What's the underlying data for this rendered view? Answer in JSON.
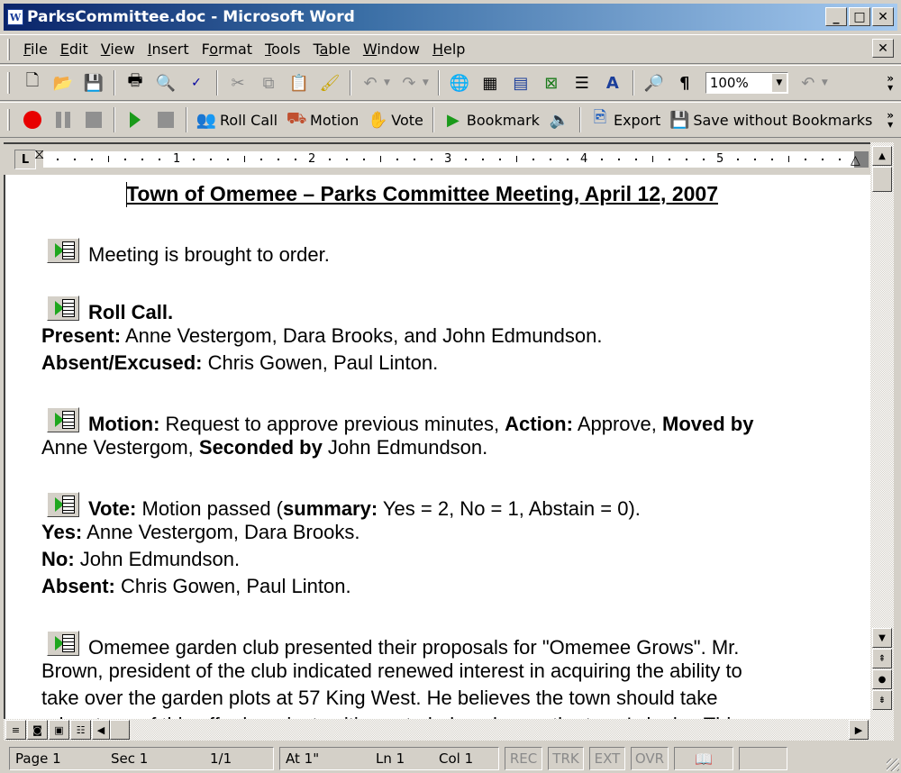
{
  "window": {
    "title": "ParksCommittee.doc - Microsoft Word",
    "app_icon": "word-doc-icon",
    "controls": [
      "minimize",
      "maximize",
      "close"
    ]
  },
  "menubar": {
    "items": [
      {
        "label": "File",
        "accel": "F"
      },
      {
        "label": "Edit",
        "accel": "E"
      },
      {
        "label": "View",
        "accel": "V"
      },
      {
        "label": "Insert",
        "accel": "I"
      },
      {
        "label": "Format",
        "accel": "o"
      },
      {
        "label": "Tools",
        "accel": "T"
      },
      {
        "label": "Table",
        "accel": "a"
      },
      {
        "label": "Window",
        "accel": "W"
      },
      {
        "label": "Help",
        "accel": "H"
      }
    ]
  },
  "standard_toolbar": {
    "zoom_value": "100%",
    "buttons": [
      "new",
      "open",
      "save",
      "print",
      "print-preview",
      "spelling",
      "cut",
      "copy",
      "paste",
      "format-painter",
      "undo",
      "redo",
      "insert-hyperlink",
      "tables-borders",
      "insert-table",
      "insert-excel",
      "columns",
      "drawing",
      "document-map",
      "show-hide"
    ]
  },
  "meeting_toolbar": {
    "buttons": [
      {
        "name": "record",
        "label": ""
      },
      {
        "name": "pause",
        "label": ""
      },
      {
        "name": "stop",
        "label": ""
      },
      {
        "name": "play",
        "label": ""
      },
      {
        "name": "stop-playback",
        "label": ""
      },
      {
        "name": "roll-call",
        "label": "Roll Call"
      },
      {
        "name": "motion",
        "label": "Motion"
      },
      {
        "name": "vote",
        "label": "Vote"
      },
      {
        "name": "bookmark",
        "label": "Bookmark"
      },
      {
        "name": "audio",
        "label": ""
      },
      {
        "name": "export",
        "label": "Export"
      },
      {
        "name": "save-without-bookmarks",
        "label": "Save without Bookmarks"
      }
    ]
  },
  "ruler": {
    "tab_selector": "L",
    "numbers": [
      "1",
      "2",
      "3",
      "4",
      "5"
    ]
  },
  "document": {
    "title": "Town of Omemee – Parks Committee Meeting, April 12, 2007",
    "p1": "Meeting is brought to order.",
    "rollcall": {
      "heading": "Roll Call.",
      "present_label": "Present:",
      "present": " Anne Vestergom, Dara Brooks, and John Edmundson.",
      "absent_label": "Absent/Excused:",
      "absent": " Chris Gowen, Paul Linton."
    },
    "motion": {
      "label": "Motion:",
      "text": " Request to approve previous minutes, ",
      "action_label": "Action:",
      "action": " Approve, ",
      "moved_label": "Moved by",
      "moved": "Anne Vestergom, ",
      "seconded_label": "Seconded by",
      "seconded": " John Edmundson."
    },
    "vote": {
      "label": "Vote:",
      "text": " Motion passed (",
      "summary_label": "summary:",
      "summary": " Yes = 2, No = 1, Abstain = 0).",
      "yes_label": "Yes:",
      "yes": " Anne Vestergom, Dara Brooks.",
      "no_label": "No:",
      "no": " John Edmundson.",
      "absent_label": "Absent:",
      "absent": " Chris Gowen, Paul Linton."
    },
    "garden": {
      "line1": "Omemee garden club presented their proposals for \"Omemee Grows\". Mr.",
      "line2": "Brown, president of the club indicated renewed interest in acquiring the ability to",
      "line3": "take over the garden plots at 57 King West. He believes the town should take",
      "line4": "advantage of this offer by private citizens to help enhance the town's looks. This"
    }
  },
  "statusbar": {
    "page": "Page 1",
    "sec": "Sec 1",
    "pages": "1/1",
    "at": "At 1\"",
    "ln": "Ln 1",
    "col": "Col 1",
    "rec": "REC",
    "trk": "TRK",
    "ext": "EXT",
    "ovr": "OVR"
  }
}
